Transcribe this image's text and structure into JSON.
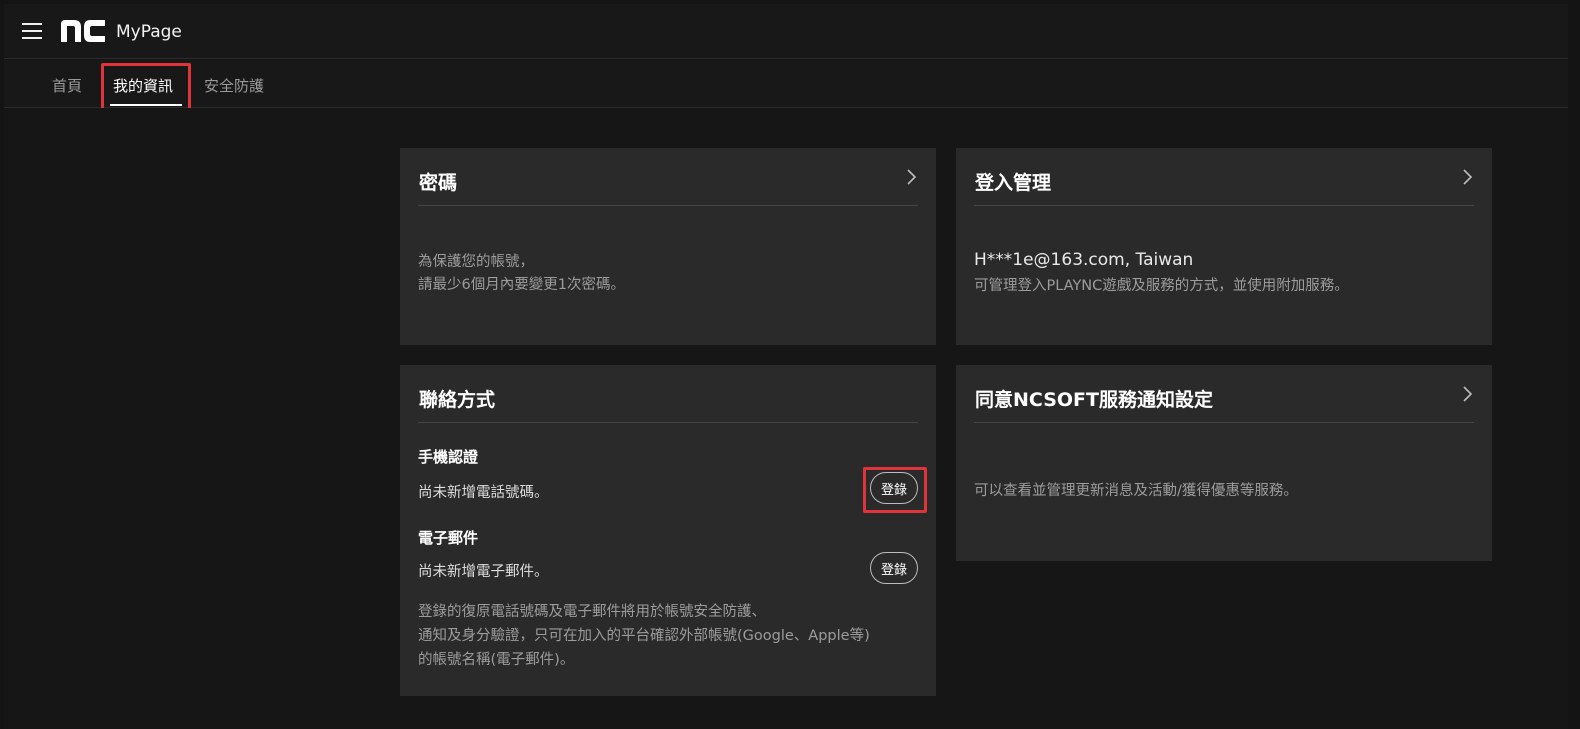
{
  "header": {
    "app_title": "MyPage",
    "logo_icon": "nc-logo-icon",
    "menu_icon": "hamburger-menu-icon"
  },
  "tabs": [
    {
      "label": "首頁",
      "active": false
    },
    {
      "label": "我的資訊",
      "active": true
    },
    {
      "label": "安全防護",
      "active": false
    }
  ],
  "cards": {
    "password": {
      "title": "密碼",
      "desc_line1": "為保護您的帳號，",
      "desc_line2": "請最少6個月內要變更1次密碼。"
    },
    "login": {
      "title": "登入管理",
      "account": "H***1e@163.com, Taiwan",
      "desc": "可管理登入PLAYNC遊戲及服務的方式，並使用附加服務。"
    },
    "contact": {
      "title": "聯絡方式",
      "phone_title": "手機認證",
      "phone_text": "尚未新增電話號碼。",
      "phone_button": "登錄",
      "email_title": "電子郵件",
      "email_text": "尚未新增電子郵件。",
      "email_button": "登錄",
      "note_line1": "登錄的復原電話號碼及電子郵件將用於帳號安全防護、",
      "note_line2": "通知及身分驗證，只可在加入的平台確認外部帳號(Google、Apple等)",
      "note_line3": "的帳號名稱(電子郵件)。"
    },
    "notify": {
      "title": "同意NCSOFT服務通知設定",
      "desc": "可以查看並管理更新消息及活動/獲得優惠等服務。"
    }
  },
  "colors": {
    "background": "#161616",
    "card": "#2a2a2a",
    "highlight": "#e0343a"
  }
}
